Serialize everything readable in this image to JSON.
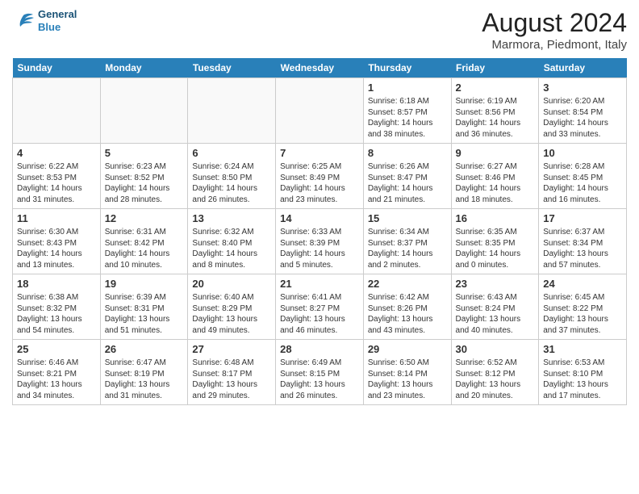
{
  "logo": {
    "line1": "General",
    "line2": "Blue"
  },
  "title": "August 2024",
  "subtitle": "Marmora, Piedmont, Italy",
  "headers": [
    "Sunday",
    "Monday",
    "Tuesday",
    "Wednesday",
    "Thursday",
    "Friday",
    "Saturday"
  ],
  "weeks": [
    [
      {
        "day": "",
        "text": ""
      },
      {
        "day": "",
        "text": ""
      },
      {
        "day": "",
        "text": ""
      },
      {
        "day": "",
        "text": ""
      },
      {
        "day": "1",
        "text": "Sunrise: 6:18 AM\nSunset: 8:57 PM\nDaylight: 14 hours\nand 38 minutes."
      },
      {
        "day": "2",
        "text": "Sunrise: 6:19 AM\nSunset: 8:56 PM\nDaylight: 14 hours\nand 36 minutes."
      },
      {
        "day": "3",
        "text": "Sunrise: 6:20 AM\nSunset: 8:54 PM\nDaylight: 14 hours\nand 33 minutes."
      }
    ],
    [
      {
        "day": "4",
        "text": "Sunrise: 6:22 AM\nSunset: 8:53 PM\nDaylight: 14 hours\nand 31 minutes."
      },
      {
        "day": "5",
        "text": "Sunrise: 6:23 AM\nSunset: 8:52 PM\nDaylight: 14 hours\nand 28 minutes."
      },
      {
        "day": "6",
        "text": "Sunrise: 6:24 AM\nSunset: 8:50 PM\nDaylight: 14 hours\nand 26 minutes."
      },
      {
        "day": "7",
        "text": "Sunrise: 6:25 AM\nSunset: 8:49 PM\nDaylight: 14 hours\nand 23 minutes."
      },
      {
        "day": "8",
        "text": "Sunrise: 6:26 AM\nSunset: 8:47 PM\nDaylight: 14 hours\nand 21 minutes."
      },
      {
        "day": "9",
        "text": "Sunrise: 6:27 AM\nSunset: 8:46 PM\nDaylight: 14 hours\nand 18 minutes."
      },
      {
        "day": "10",
        "text": "Sunrise: 6:28 AM\nSunset: 8:45 PM\nDaylight: 14 hours\nand 16 minutes."
      }
    ],
    [
      {
        "day": "11",
        "text": "Sunrise: 6:30 AM\nSunset: 8:43 PM\nDaylight: 14 hours\nand 13 minutes."
      },
      {
        "day": "12",
        "text": "Sunrise: 6:31 AM\nSunset: 8:42 PM\nDaylight: 14 hours\nand 10 minutes."
      },
      {
        "day": "13",
        "text": "Sunrise: 6:32 AM\nSunset: 8:40 PM\nDaylight: 14 hours\nand 8 minutes."
      },
      {
        "day": "14",
        "text": "Sunrise: 6:33 AM\nSunset: 8:39 PM\nDaylight: 14 hours\nand 5 minutes."
      },
      {
        "day": "15",
        "text": "Sunrise: 6:34 AM\nSunset: 8:37 PM\nDaylight: 14 hours\nand 2 minutes."
      },
      {
        "day": "16",
        "text": "Sunrise: 6:35 AM\nSunset: 8:35 PM\nDaylight: 14 hours\nand 0 minutes."
      },
      {
        "day": "17",
        "text": "Sunrise: 6:37 AM\nSunset: 8:34 PM\nDaylight: 13 hours\nand 57 minutes."
      }
    ],
    [
      {
        "day": "18",
        "text": "Sunrise: 6:38 AM\nSunset: 8:32 PM\nDaylight: 13 hours\nand 54 minutes."
      },
      {
        "day": "19",
        "text": "Sunrise: 6:39 AM\nSunset: 8:31 PM\nDaylight: 13 hours\nand 51 minutes."
      },
      {
        "day": "20",
        "text": "Sunrise: 6:40 AM\nSunset: 8:29 PM\nDaylight: 13 hours\nand 49 minutes."
      },
      {
        "day": "21",
        "text": "Sunrise: 6:41 AM\nSunset: 8:27 PM\nDaylight: 13 hours\nand 46 minutes."
      },
      {
        "day": "22",
        "text": "Sunrise: 6:42 AM\nSunset: 8:26 PM\nDaylight: 13 hours\nand 43 minutes."
      },
      {
        "day": "23",
        "text": "Sunrise: 6:43 AM\nSunset: 8:24 PM\nDaylight: 13 hours\nand 40 minutes."
      },
      {
        "day": "24",
        "text": "Sunrise: 6:45 AM\nSunset: 8:22 PM\nDaylight: 13 hours\nand 37 minutes."
      }
    ],
    [
      {
        "day": "25",
        "text": "Sunrise: 6:46 AM\nSunset: 8:21 PM\nDaylight: 13 hours\nand 34 minutes."
      },
      {
        "day": "26",
        "text": "Sunrise: 6:47 AM\nSunset: 8:19 PM\nDaylight: 13 hours\nand 31 minutes."
      },
      {
        "day": "27",
        "text": "Sunrise: 6:48 AM\nSunset: 8:17 PM\nDaylight: 13 hours\nand 29 minutes."
      },
      {
        "day": "28",
        "text": "Sunrise: 6:49 AM\nSunset: 8:15 PM\nDaylight: 13 hours\nand 26 minutes."
      },
      {
        "day": "29",
        "text": "Sunrise: 6:50 AM\nSunset: 8:14 PM\nDaylight: 13 hours\nand 23 minutes."
      },
      {
        "day": "30",
        "text": "Sunrise: 6:52 AM\nSunset: 8:12 PM\nDaylight: 13 hours\nand 20 minutes."
      },
      {
        "day": "31",
        "text": "Sunrise: 6:53 AM\nSunset: 8:10 PM\nDaylight: 13 hours\nand 17 minutes."
      }
    ]
  ]
}
